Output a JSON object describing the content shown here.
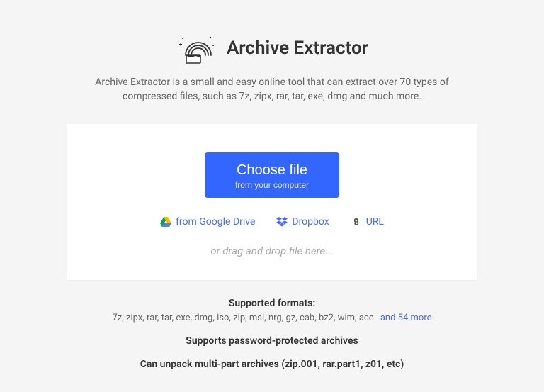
{
  "header": {
    "title": "Archive Extractor",
    "subtitle": "Archive Extractor is a small and easy online tool that can extract over 70 types of compressed files, such as 7z, zipx, rar, tar, exe, dmg and much more."
  },
  "uploader": {
    "choose_label": "Choose file",
    "choose_sub": "from your computer",
    "sources": {
      "gdrive": "from Google Drive",
      "dropbox": "Dropbox",
      "url": "URL"
    },
    "hint": "or drag and drop file here..."
  },
  "footer": {
    "supported_heading": "Supported formats:",
    "formats": "7z, zipx, rar, tar, exe, dmg, iso, zip, msi, nrg, gz, cab, bz2, wim, ace",
    "more": "and 54 more",
    "password_line": "Supports password-protected archives",
    "multipart_line": "Can unpack multi-part archives (zip.001, rar.part1, z01, etc)"
  }
}
